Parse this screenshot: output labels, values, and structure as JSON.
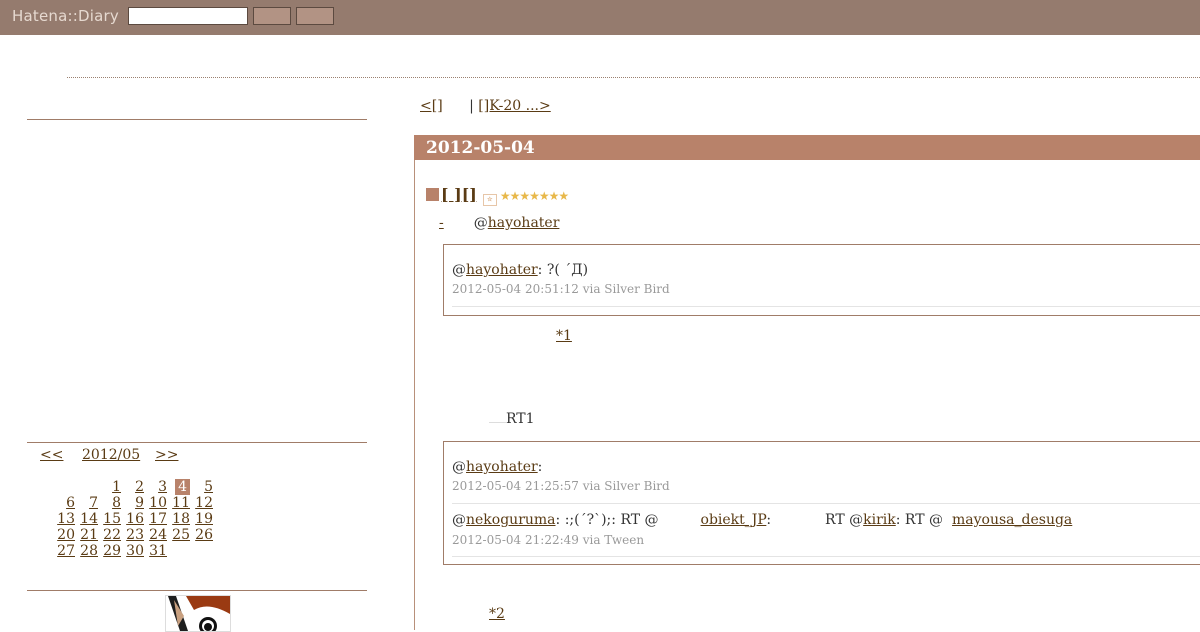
{
  "header": {
    "logo": "Hatena::Diary",
    "search_value": "",
    "button1_label": "",
    "button2_label": ""
  },
  "calendar": {
    "prev": "<<",
    "month": "2012/05",
    "next": ">>",
    "today": 4,
    "weeks": [
      [
        "",
        "",
        "",
        1,
        2,
        3,
        4,
        5
      ],
      [
        "",
        6,
        7,
        8,
        9,
        10,
        11,
        12
      ],
      [
        "",
        13,
        14,
        15,
        16,
        17,
        18,
        19
      ],
      [
        "",
        20,
        21,
        22,
        23,
        24,
        25,
        26
      ],
      [
        "",
        27,
        28,
        29,
        30,
        31,
        "",
        ""
      ]
    ]
  },
  "pager": {
    "prev": "<[]",
    "divider": "|",
    "next": "[]K-20 ...>"
  },
  "day": {
    "date": "2012-05-04",
    "entry_title": "[ ][]",
    "stars": "★★★★★★★",
    "byline_prefix": "-",
    "byline_at": "@",
    "byline_user": "hayohater",
    "footnote1": "*1",
    "rt_label": "RT1",
    "footnote2": "*2"
  },
  "tweets1": [
    {
      "at": "@",
      "user": "hayohater",
      "text": ": ?( ´Д)",
      "meta": "2012-05-04 20:51:12 via Silver Bird"
    }
  ],
  "tweets2": [
    {
      "at": "@",
      "user": "hayohater",
      "text": ":",
      "meta": "2012-05-04 21:25:57 via Silver Bird"
    },
    {
      "at": "@",
      "user": "nekoguruma",
      "text": ": :;(´?`);: RT @",
      "user2": "obiekt_JP",
      "text2": ":",
      "text3": "RT @",
      "user3": "kirik",
      "text4": ":  RT @",
      "user4": "mayousa_desuga",
      "meta": "2012-05-04 21:22:49 via Tween"
    }
  ]
}
